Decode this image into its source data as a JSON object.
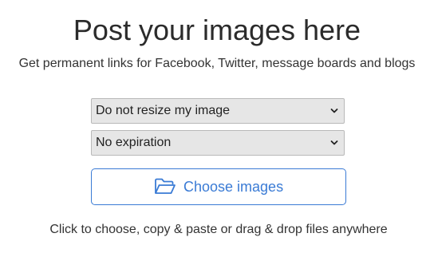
{
  "header": {
    "title": "Post your images here",
    "subtitle": "Get permanent links for Facebook, Twitter, message boards and blogs"
  },
  "resize_select": {
    "value": "Do not resize my image"
  },
  "expiration_select": {
    "value": "No expiration"
  },
  "upload": {
    "button_label": "Choose images",
    "icon": "folder-open-icon",
    "accent_color": "#3a7bd5"
  },
  "hint": {
    "text": "Click to choose, copy & paste or drag & drop files anywhere"
  }
}
